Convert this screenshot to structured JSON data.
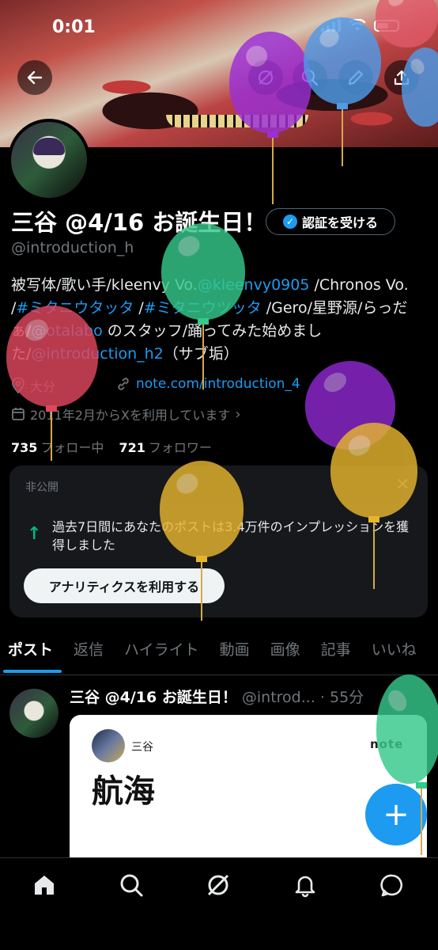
{
  "status_bar": {
    "time": "0:01"
  },
  "header": {
    "back_icon": "arrow-left-icon",
    "grok_icon": "slash-circle-icon",
    "search_icon": "search-icon",
    "edit_icon": "pencil-icon",
    "share_icon": "share-icon"
  },
  "profile": {
    "name": "三谷 @4/16 お誕生日！",
    "verify_button": "認証を受ける",
    "handle": "@introduction_h",
    "bio": {
      "t1": "被写体/歌い手/kleenvy Vo.",
      "l1": "@kleenvy0905",
      "t2": " /Chronos Vo. /",
      "l2": "#ミタニウタッタ",
      "t3": " /",
      "l3": "#ミタニウツッタ",
      "t4": " /Gero/星野源/らっだぁ/",
      "l4": "@otalabo",
      "t5": " のスタッフ/踊ってみた始めました/",
      "l5": "@introduction_h2",
      "t6": "（サブ垢）"
    },
    "location": "大分",
    "website": "note.com/introduction_4",
    "joined": "2011年2月からXを利用しています",
    "following_count": "735",
    "following_label": "フォロー中",
    "followers_count": "721",
    "followers_label": "フォロワー"
  },
  "analytics_card": {
    "label": "非公開",
    "text": "過去7日間にあなたのポストは3.4万件のインプレッションを獲得しました",
    "button": "アナリティクスを利用する"
  },
  "tabs": [
    {
      "label": "ポスト",
      "active": true
    },
    {
      "label": "返信"
    },
    {
      "label": "ハイライト"
    },
    {
      "label": "動画"
    },
    {
      "label": "画像"
    },
    {
      "label": "記事"
    },
    {
      "label": "いいね"
    }
  ],
  "post": {
    "author": "三谷 @4/16 お誕生日！",
    "handle_time": "@introd... · 55分",
    "embed": {
      "author": "三谷",
      "brand": "note",
      "title": "航海"
    }
  },
  "fab_label": "+",
  "bottom_nav": [
    "home-icon",
    "search-icon",
    "grok-icon",
    "bell-icon",
    "messages-icon"
  ],
  "colors": {
    "accent": "#1d9bf0",
    "background": "#000000",
    "success": "#00ba7c"
  }
}
